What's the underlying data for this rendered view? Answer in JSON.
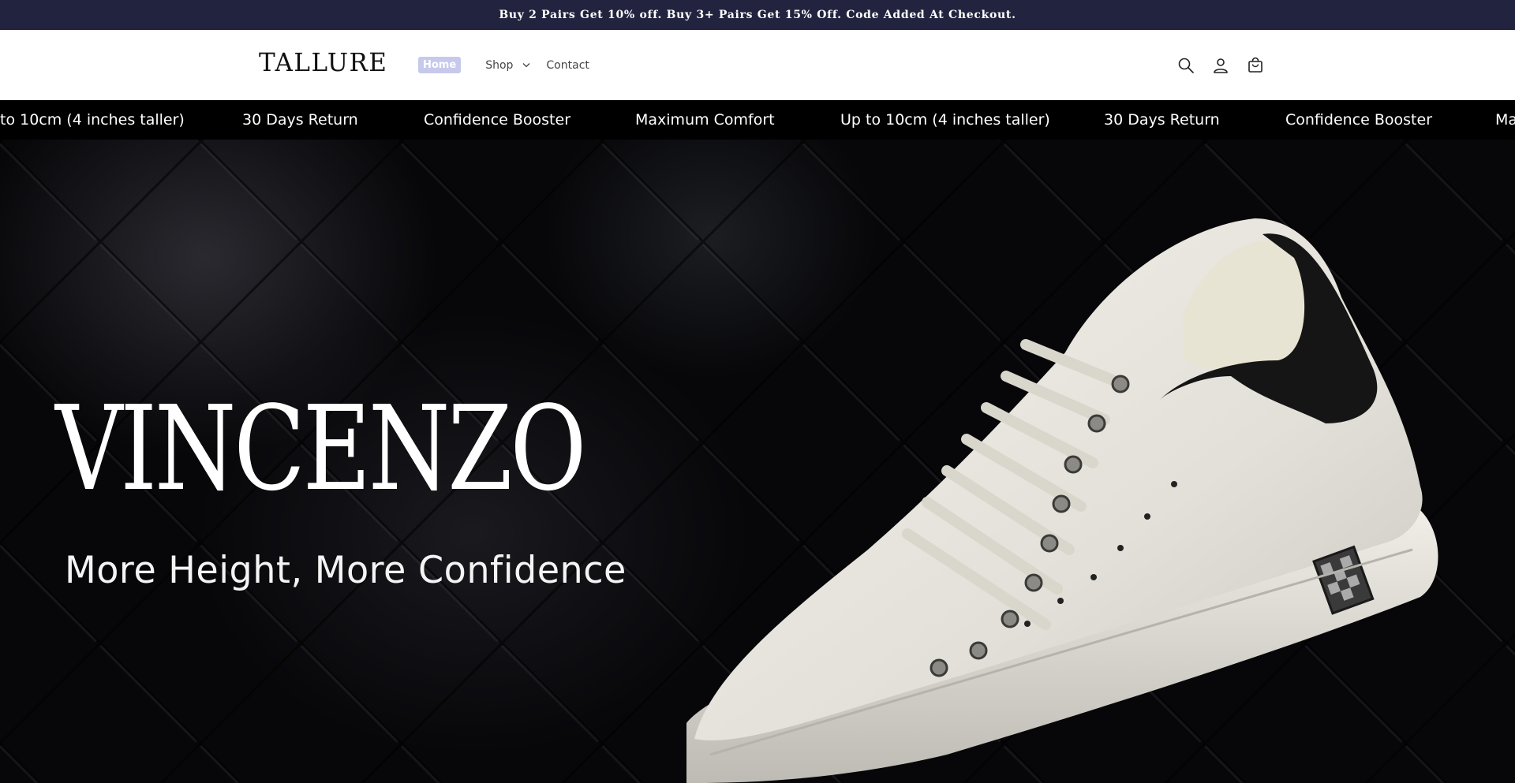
{
  "announcement": {
    "text": "Buy 2 Pairs Get 10% off. Buy 3+ Pairs Get 15% Off. Code Added At Checkout."
  },
  "header": {
    "logo": "TALLURE",
    "nav": {
      "home": "Home",
      "shop": "Shop",
      "contact": "Contact"
    },
    "icons": [
      "search-icon",
      "account-icon",
      "cart-icon"
    ]
  },
  "marquee": {
    "items": [
      "to 10cm (4 inches taller)",
      "30 Days Return",
      "Confidence Booster",
      "Maximum Comfort",
      "Up to 10cm (4 inches taller)",
      "30 Days Return",
      "Confidence Booster",
      "Ma"
    ]
  },
  "hero": {
    "title": "VINCENZO",
    "subtitle": "More Height, More Confidence"
  },
  "colors": {
    "announcement_bg": "#22243f",
    "home_highlight": "#c7c9ec",
    "marquee_bg": "#000000"
  }
}
